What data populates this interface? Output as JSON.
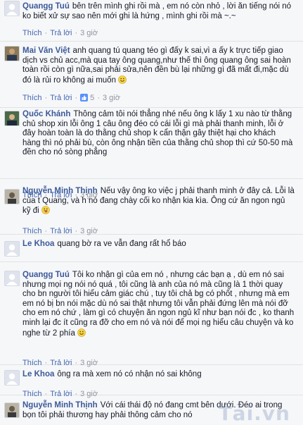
{
  "comments": [
    {
      "author": "Quangg Tuú",
      "text": "bên trên mình ghi rồi mà , em nó còn nhỏ , lời ăn tiếng nói nó ko biết xử sự sao nên mới ghi là hứng , mình ghi rồi mà ~.~",
      "emoji": "",
      "actions": {
        "like": "Thích",
        "reply": "Trả lời",
        "time": "3 giờ",
        "likes": ""
      }
    },
    {
      "author": "Mai Văn Việt",
      "text": "anh quang tú quang téo gì đấy k sai,vì a ấy k trực tiếp giao dịch vs chủ acc,mà qua tay ông quang,như thế thì ông quang ông sai hoàn toàn rồi còn gì nữa,sai phải sửa,nên đền bù lại những gì đã mất đi,mặc dù đó là rủi ro không ai muốn",
      "emoji": "smile",
      "actions": {
        "like": "Thích",
        "reply": "Trả lời",
        "time": "3 giờ",
        "likes": "5"
      }
    },
    {
      "author": "Quốc Khánh",
      "text": "Thông cảm tôi nói thẳng nhé nếu ông k lấy 1 xu nào từ thằng chủ shop xin lỗi ông 1 câu ông đéo có cái lỗi gì mà phải thanh minh, lỗi ở đây hoàn toàn là do thằng chủ shop k cẩn thận gây thiệt hại cho khách hàng thì nó phải bù, còn ông nhận tiền của thằng chủ shop thì cứ 50-50 mà đền cho nó sòng phẳng",
      "emoji": "",
      "actions": {
        "like": "Thích",
        "reply": "Trả lời",
        "time": "3 giờ",
        "likes": ""
      }
    },
    {
      "author": "Nguyễn Minh Thịnh",
      "text": "Nếu vậy ông ko việc j phải thanh minh ở đây cả. Lỗi là của t Quang, và h nó đang chày cối ko nhận kia kìa. Ông cứ ăn ngon ngủ kỹ đi",
      "emoji": "tongue",
      "actions": {
        "like": "Thích",
        "reply": "Trả lời",
        "time": "3 giờ",
        "likes": ""
      }
    },
    {
      "author": "Le Khoa",
      "text": "quang bờ ra ve vẫn đang rất hổ báo",
      "emoji": "",
      "actions": {
        "like": "Thích",
        "reply": "Trả lời",
        "time": "3 giờ",
        "likes": ""
      }
    },
    {
      "author": "Quangg Tuú",
      "text": "Tôi ko nhận gì của em nó , nhưng các bạn ạ , dù em nó sai nhưng mọi ng nói nó quá , tôi cũng là anh của nó mà cũng là 1 thời quay cho bn người tôi hiểu cảm giác chú , tuy tôi chả bg có phốt , nhưng mà em em nó bị bn nói mặc dù nó sai thật nhưng tôi vẫn phải đứng lên mà nói đỡ cho em nó chứ , làm gì có chuyện ăn ngon ngủ kĩ như bạn nói đc , ko thanh minh lại đc ít cũng ra đỡ cho em nó và nói để mọi ng hiểu câu chuyện và ko nghe từ 2 phía",
      "emoji": "smile",
      "actions": {
        "like": "Thích",
        "reply": "Trả lời",
        "time": "3 giờ",
        "likes": ""
      }
    },
    {
      "author": "Le Khoa",
      "text": "ông ra mà xem nó có nhận nó sai không",
      "emoji": "",
      "actions": {
        "like": "Thích",
        "reply": "Trả lời",
        "time": "3 giờ",
        "likes": ""
      }
    },
    {
      "author": "Nguyễn Minh Thịnh",
      "text": "Với cái thái độ nó đang cmt bên dưới. Đéo ai trong bọn tôi phải thương hay phải thông cảm cho nó",
      "emoji": "",
      "actions": {
        "like": "",
        "reply": "",
        "time": "",
        "likes": ""
      }
    }
  ],
  "colors": {
    "author": "#3b5998",
    "link": "#4267b2",
    "meta": "#90949c",
    "bg": "#f6f7f9"
  },
  "watermark": "Tải.vn"
}
